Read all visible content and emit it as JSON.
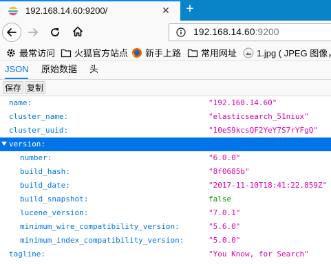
{
  "tab": {
    "title": "192.168.14.60:9200/",
    "close_glyph": "✕",
    "new_tab_glyph": "+"
  },
  "urlbar": {
    "host": "192.168.14.60",
    "port": ":9200"
  },
  "bookmarks": [
    {
      "label": "最常访问",
      "icon": "gear-icon"
    },
    {
      "label": "火狐官方站点",
      "icon": "folder-icon"
    },
    {
      "label": "新手上路",
      "icon": "firefox-icon"
    },
    {
      "label": "常用网址",
      "icon": "folder-icon"
    },
    {
      "label": "1.jpg ( JPEG 图像，",
      "icon": "image-icon"
    }
  ],
  "viewer_tabs": [
    "JSON",
    "原始数据",
    "头"
  ],
  "toolbar": {
    "save_label": "保存",
    "copy_label": "复制"
  },
  "json_tree": [
    {
      "key": "name:",
      "value": "\"192.168.14.60\"",
      "kind": "string",
      "indent": 0
    },
    {
      "key": "cluster_name:",
      "value": "\"elasticsearch_51niux\"",
      "kind": "string",
      "indent": 0
    },
    {
      "key": "cluster_uuid:",
      "value": "\"10eS9kcsQF2YeY7S7rYFgQ\"",
      "kind": "string",
      "indent": 0
    },
    {
      "key": "version:",
      "value": "",
      "kind": "object",
      "indent": 0,
      "selected": true
    },
    {
      "key": "number:",
      "value": "\"6.0.0\"",
      "kind": "string",
      "indent": 1
    },
    {
      "key": "build_hash:",
      "value": "\"8f0685b\"",
      "kind": "string",
      "indent": 1
    },
    {
      "key": "build_date:",
      "value": "\"2017-11-10T18:41:22.859Z\"",
      "kind": "string",
      "indent": 1
    },
    {
      "key": "build_snapshot:",
      "value": "false",
      "kind": "bool",
      "indent": 1
    },
    {
      "key": "lucene_version:",
      "value": "\"7.0.1\"",
      "kind": "string",
      "indent": 1
    },
    {
      "key": "minimum_wire_compatibility_version:",
      "value": "\"5.6.0\"",
      "kind": "string",
      "indent": 1
    },
    {
      "key": "minimum_index_compatibility_version:",
      "value": "\"5.0.0\"",
      "kind": "string",
      "indent": 1
    },
    {
      "key": "tagline:",
      "value": "\"You Know, for Search\"",
      "kind": "string",
      "indent": 0
    }
  ]
}
